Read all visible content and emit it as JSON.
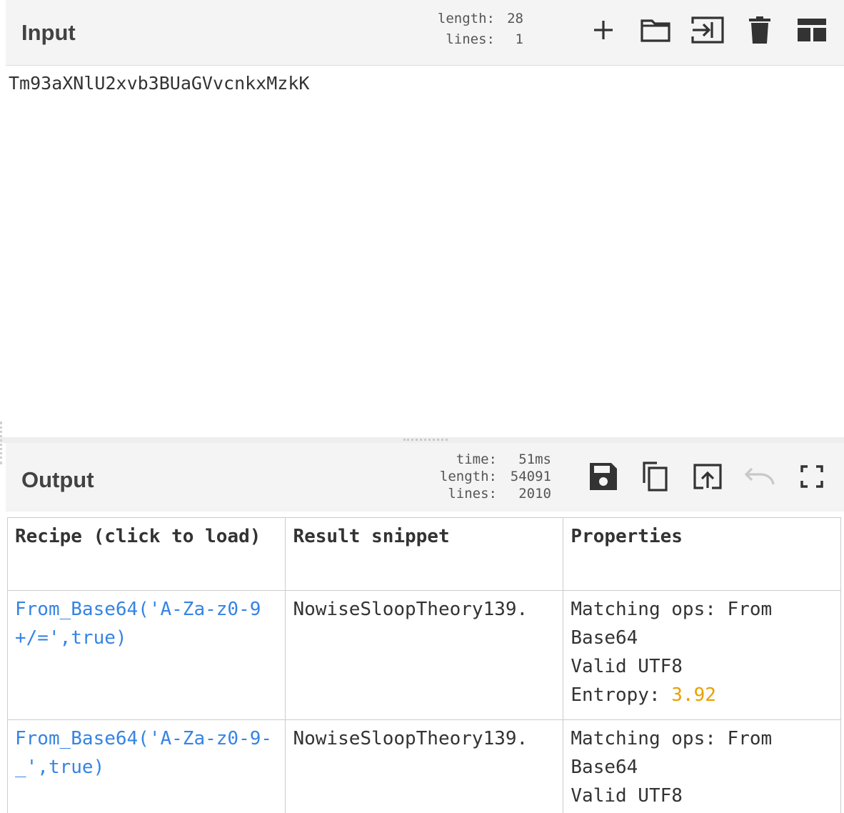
{
  "input": {
    "title": "Input",
    "stats": {
      "length_label": "length:",
      "length": "28",
      "lines_label": "lines:",
      "lines": "1"
    },
    "text": "Tm93aXNlU2xvb3BUaGVvcnkxMzkK",
    "buttons": [
      "add-icon",
      "open-folder-icon",
      "import-icon",
      "trash-icon",
      "layout-icon"
    ]
  },
  "output": {
    "title": "Output",
    "stats": {
      "time_label": "time:",
      "time": "51ms",
      "length_label": "length:",
      "length": "54091",
      "lines_label": "lines:",
      "lines": "2010"
    },
    "buttons": [
      "save-icon",
      "copy-icon",
      "replace-input-icon",
      "undo-icon",
      "fullscreen-icon"
    ],
    "table": {
      "headers": [
        "Recipe (click to load)",
        "Result snippet",
        "Properties"
      ],
      "rows": [
        {
          "recipe": "From_Base64('A-Za-z0-9+/=',true)",
          "snippet": "NowiseSloopTheory139.",
          "props": [
            "Matching ops: From Base64",
            "Valid UTF8"
          ],
          "entropy_label": "Entropy: ",
          "entropy": "3.92"
        },
        {
          "recipe": "From_Base64('A-Za-z0-9-_',true)",
          "snippet": "NowiseSloopTheory139.",
          "props": [
            "Matching ops: From Base64",
            "Valid UTF8"
          ]
        }
      ]
    }
  },
  "colors": {
    "link": "#3584e4",
    "entropy": "#e8a000",
    "header_bg": "#f4f4f4"
  }
}
